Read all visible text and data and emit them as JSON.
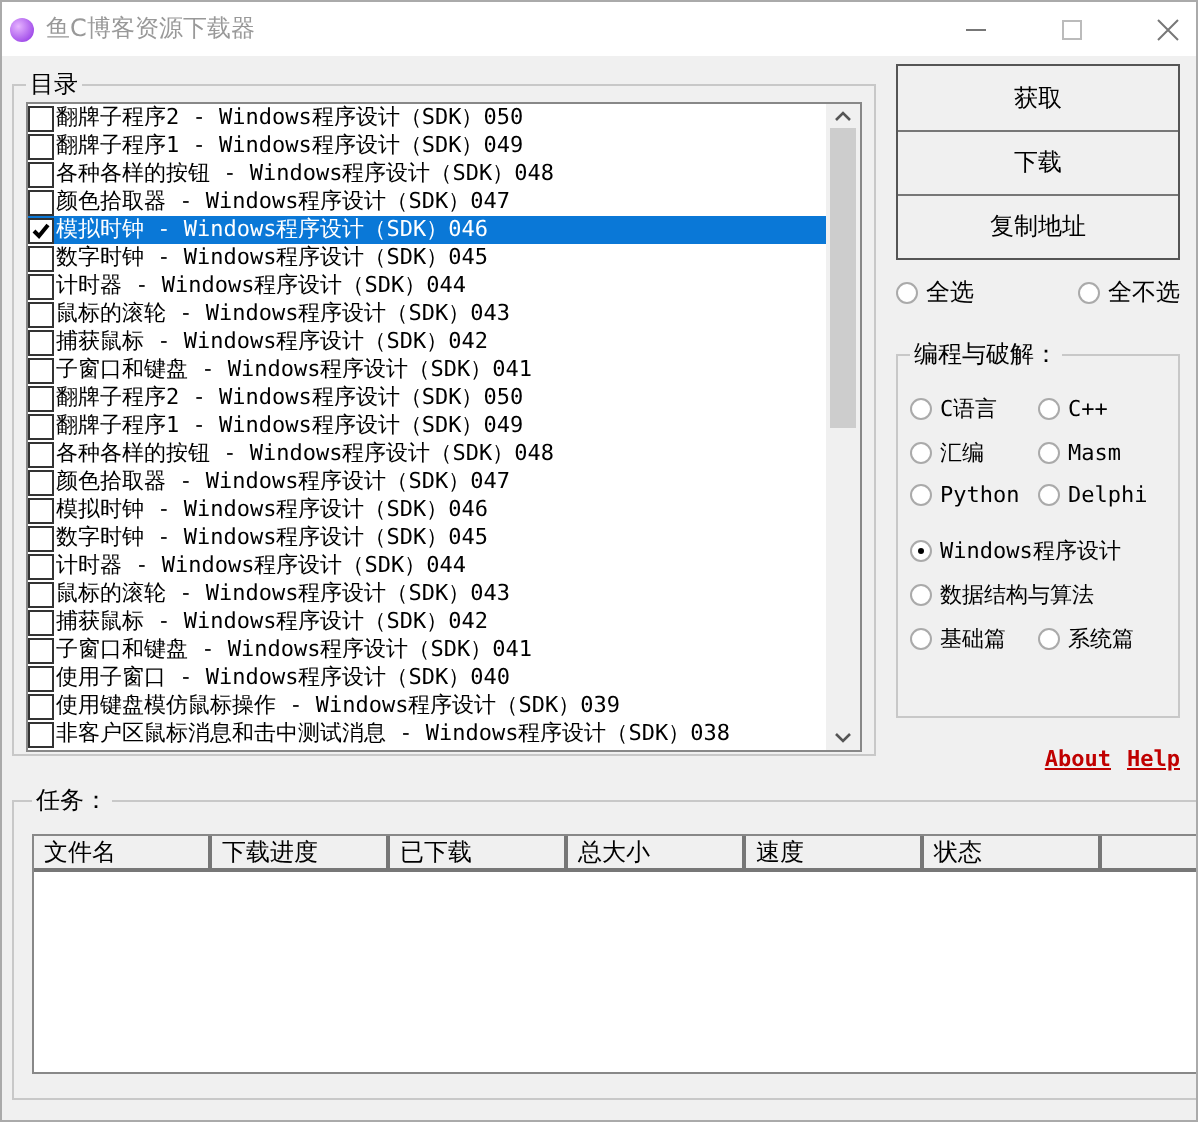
{
  "window": {
    "title": "鱼C博客资源下载器"
  },
  "catalog": {
    "label": "目录",
    "items": [
      {
        "text": "翻牌子程序2 - Windows程序设计（SDK）050",
        "checked": false,
        "selected": false
      },
      {
        "text": "翻牌子程序1 - Windows程序设计（SDK）049",
        "checked": false,
        "selected": false
      },
      {
        "text": "各种各样的按钮 - Windows程序设计（SDK）048",
        "checked": false,
        "selected": false
      },
      {
        "text": "颜色拾取器 - Windows程序设计（SDK）047",
        "checked": false,
        "selected": false
      },
      {
        "text": "模拟时钟 - Windows程序设计（SDK）046",
        "checked": true,
        "selected": true
      },
      {
        "text": "数字时钟 - Windows程序设计（SDK）045",
        "checked": false,
        "selected": false
      },
      {
        "text": "计时器 - Windows程序设计（SDK）044",
        "checked": false,
        "selected": false
      },
      {
        "text": "鼠标的滚轮 - Windows程序设计（SDK）043",
        "checked": false,
        "selected": false
      },
      {
        "text": "捕获鼠标 - Windows程序设计（SDK）042",
        "checked": false,
        "selected": false
      },
      {
        "text": "子窗口和键盘 - Windows程序设计（SDK）041",
        "checked": false,
        "selected": false
      },
      {
        "text": "翻牌子程序2 - Windows程序设计（SDK）050",
        "checked": false,
        "selected": false
      },
      {
        "text": "翻牌子程序1 - Windows程序设计（SDK）049",
        "checked": false,
        "selected": false
      },
      {
        "text": "各种各样的按钮 - Windows程序设计（SDK）048",
        "checked": false,
        "selected": false
      },
      {
        "text": "颜色拾取器 - Windows程序设计（SDK）047",
        "checked": false,
        "selected": false
      },
      {
        "text": "模拟时钟 - Windows程序设计（SDK）046",
        "checked": false,
        "selected": false
      },
      {
        "text": "数字时钟 - Windows程序设计（SDK）045",
        "checked": false,
        "selected": false
      },
      {
        "text": "计时器 - Windows程序设计（SDK）044",
        "checked": false,
        "selected": false
      },
      {
        "text": "鼠标的滚轮 - Windows程序设计（SDK）043",
        "checked": false,
        "selected": false
      },
      {
        "text": "捕获鼠标 - Windows程序设计（SDK）042",
        "checked": false,
        "selected": false
      },
      {
        "text": "子窗口和键盘 - Windows程序设计（SDK）041",
        "checked": false,
        "selected": false
      },
      {
        "text": "使用子窗口 - Windows程序设计（SDK）040",
        "checked": false,
        "selected": false
      },
      {
        "text": "使用键盘模仿鼠标操作 - Windows程序设计（SDK）039",
        "checked": false,
        "selected": false
      },
      {
        "text": "非客户区鼠标消息和击中测试消息 - Windows程序设计（SDK）038",
        "checked": false,
        "selected": false
      }
    ]
  },
  "buttons": [
    "获取",
    "下载",
    "复制地址"
  ],
  "selection": [
    {
      "label": "全选",
      "selected": false
    },
    {
      "label": "全不选",
      "selected": false
    }
  ],
  "category": {
    "label": "编程与破解：",
    "rows": [
      [
        {
          "label": "C语言",
          "selected": false
        },
        {
          "label": "C++",
          "selected": false
        }
      ],
      [
        {
          "label": "汇编",
          "selected": false
        },
        {
          "label": "Masm",
          "selected": false
        }
      ],
      [
        {
          "label": "Python",
          "selected": false
        },
        {
          "label": "Delphi",
          "selected": false
        }
      ],
      [
        {
          "label": "Windows程序设计",
          "selected": true
        }
      ],
      [
        {
          "label": "数据结构与算法",
          "selected": false
        }
      ],
      [
        {
          "label": "基础篇",
          "selected": false
        },
        {
          "label": "系统篇",
          "selected": false
        }
      ]
    ]
  },
  "links": [
    "About",
    "Help"
  ],
  "tasks": {
    "label": "任务：",
    "columns": [
      "文件名",
      "下载进度",
      "已下载",
      "总大小",
      "速度",
      "状态"
    ]
  }
}
